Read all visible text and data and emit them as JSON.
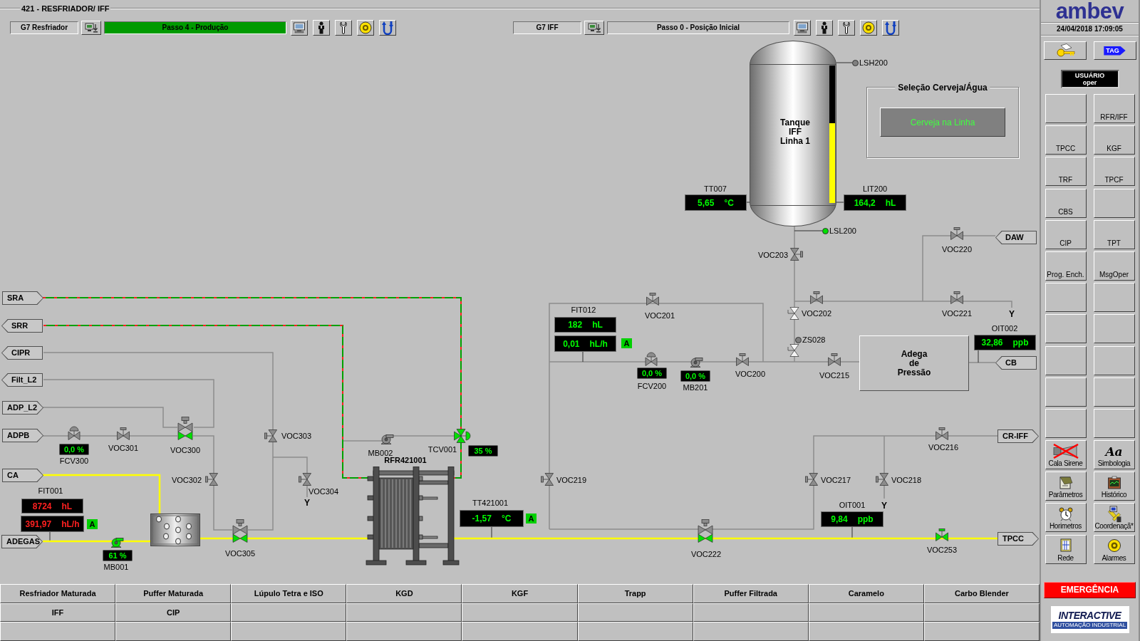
{
  "header": {
    "title": "421 - RESFRIADOR/ IFF"
  },
  "units": [
    {
      "name": "G7 Resfriador",
      "step": "Passo 4 - Produção",
      "running": true
    },
    {
      "name": "G7 IFF",
      "step": "Passo 0 - Posição Inicial",
      "running": false
    }
  ],
  "tank": {
    "lines": [
      "Tanque",
      "IFF",
      "Linha 1"
    ],
    "level": 0.58
  },
  "selection": {
    "title": "Seleção Cerveja/Água",
    "button": "Cerveja na Linha"
  },
  "switches": [
    {
      "tag": "LSH200",
      "active": false
    },
    {
      "tag": "LSL200",
      "active": true
    },
    {
      "tag": "ZS028",
      "active": false
    }
  ],
  "instruments": [
    {
      "tag": "TT007",
      "alarm": false,
      "readings": [
        {
          "value": "5,65",
          "unit": "°C"
        }
      ]
    },
    {
      "tag": "LIT200",
      "alarm": false,
      "readings": [
        {
          "value": "164,2",
          "unit": "hL"
        }
      ]
    },
    {
      "tag": "FIT012",
      "alarm": false,
      "readings": [
        {
          "value": "182",
          "unit": "hL"
        },
        {
          "value": "0,01",
          "unit": "hL/h"
        }
      ],
      "mode": "A"
    },
    {
      "tag": "OIT002",
      "alarm": false,
      "readings": [
        {
          "value": "32,86",
          "unit": "ppb"
        }
      ]
    },
    {
      "tag": "FIT001",
      "alarm": true,
      "readings": [
        {
          "value": "8724",
          "unit": "hL"
        },
        {
          "value": "391,97",
          "unit": "hL/h"
        }
      ],
      "mode": "A"
    },
    {
      "tag": "TT421001",
      "alarm": false,
      "readings": [
        {
          "value": "-1,57",
          "unit": "°C"
        }
      ],
      "mode": "A"
    },
    {
      "tag": "OIT001",
      "alarm": false,
      "readings": [
        {
          "value": "9,84",
          "unit": "ppb"
        }
      ]
    }
  ],
  "connectors": [
    {
      "label": "SRA",
      "kind": "right"
    },
    {
      "label": "SRR",
      "kind": "left"
    },
    {
      "label": "CIPR",
      "kind": "left"
    },
    {
      "label": "Filt_L2",
      "kind": "left"
    },
    {
      "label": "ADP_L2",
      "kind": "right"
    },
    {
      "label": "ADPB",
      "kind": "right"
    },
    {
      "label": "CA",
      "kind": "right"
    },
    {
      "label": "ADEGAS",
      "kind": "right"
    },
    {
      "label": "DAW",
      "kind": "left"
    },
    {
      "label": "CB",
      "kind": "left"
    },
    {
      "label": "CR-IFF",
      "kind": "right"
    },
    {
      "label": "TPCC",
      "kind": "right"
    }
  ],
  "vessel": {
    "lines": [
      "Adega",
      "de",
      "Pressão"
    ]
  },
  "valves": [
    {
      "tag": "VOC203",
      "kind": "onoff",
      "open": false
    },
    {
      "tag": "VOC220",
      "kind": "onoff",
      "open": false
    },
    {
      "tag": "VOC201",
      "kind": "onoff",
      "open": false
    },
    {
      "tag": "VOC202",
      "kind": "onoff",
      "open": false
    },
    {
      "tag": "VOC221",
      "kind": "onoff",
      "open": false
    },
    {
      "tag": "FCV200",
      "kind": "control",
      "open": false,
      "reading": "0,0 %"
    },
    {
      "tag": "VOC200",
      "kind": "onoff",
      "open": false
    },
    {
      "tag": "VOC215",
      "kind": "onoff",
      "open": false
    },
    {
      "tag": "FCV300",
      "kind": "control",
      "open": false,
      "reading": "0,0 %"
    },
    {
      "tag": "VOC301",
      "kind": "onoff",
      "open": false
    },
    {
      "tag": "VOC300",
      "kind": "double",
      "open": true
    },
    {
      "tag": "VOC303",
      "kind": "onoff",
      "open": false
    },
    {
      "tag": "TCV001",
      "kind": "threeway",
      "open": true,
      "reading": "35 %"
    },
    {
      "tag": "VOC216",
      "kind": "onoff",
      "open": false
    },
    {
      "tag": "VOC302",
      "kind": "onoff",
      "open": false
    },
    {
      "tag": "VOC219",
      "kind": "onoff",
      "open": false
    },
    {
      "tag": "VOC217",
      "kind": "onoff",
      "open": false
    },
    {
      "tag": "VOC218",
      "kind": "onoff",
      "open": false
    },
    {
      "tag": "VOC304",
      "kind": "onoff",
      "open": false
    },
    {
      "tag": "VOC305",
      "kind": "double",
      "open": true
    },
    {
      "tag": "VOC222",
      "kind": "double",
      "open": true
    },
    {
      "tag": "VOC253",
      "kind": "onoff",
      "open": true
    }
  ],
  "pumps": [
    {
      "tag": "MB002",
      "running": false
    },
    {
      "tag": "MB201",
      "running": false,
      "reading": "0,0 %"
    },
    {
      "tag": "MB001",
      "running": true,
      "reading": "61 %"
    }
  ],
  "heat_exchanger": {
    "tag": "RFR421001"
  },
  "drains": [
    "Y",
    "Y",
    "Y"
  ],
  "bottom_menu": [
    "Resfriador Maturada",
    "Puffer Maturada",
    "Lúpulo Tetra e ISO",
    "KGD",
    "KGF",
    "Trapp",
    "Puffer Filtrada",
    "Caramelo",
    "Carbo Blender",
    "IFF",
    "CIP"
  ],
  "sidebar": {
    "logo": "ambev",
    "datetime": "24/04/2018 17:09:05",
    "tag_button": "TAG",
    "user": {
      "title": "USUÁRIO",
      "name": "oper"
    },
    "nav_buttons": [
      {
        "kind": "blank"
      },
      {
        "kind": "text",
        "label": "RFR/IFF"
      },
      {
        "kind": "text",
        "label": "TPCC"
      },
      {
        "kind": "text",
        "label": "KGF"
      },
      {
        "kind": "text",
        "label": "TRF"
      },
      {
        "kind": "text",
        "label": "TPCF"
      },
      {
        "kind": "text",
        "label": "CBS"
      },
      {
        "kind": "blank"
      },
      {
        "kind": "text",
        "label": "CIP"
      },
      {
        "kind": "text",
        "label": "TPT"
      },
      {
        "kind": "text",
        "label": "Prog. Ench."
      },
      {
        "kind": "text",
        "label": "MsgOper"
      },
      {
        "kind": "blank"
      },
      {
        "kind": "blank"
      },
      {
        "kind": "blank"
      },
      {
        "kind": "blank"
      },
      {
        "kind": "blank"
      },
      {
        "kind": "blank"
      },
      {
        "kind": "blank"
      },
      {
        "kind": "blank"
      },
      {
        "kind": "blank"
      },
      {
        "kind": "blank"
      }
    ],
    "tool_glyph": "Aa",
    "tools": [
      {
        "label": "Cala Sirene"
      },
      {
        "label": "Simbologia"
      },
      {
        "label": "Parâmetros"
      },
      {
        "label": "Histórico"
      },
      {
        "label": "Horimetros"
      },
      {
        "label": "Coordenaçã*"
      },
      {
        "label": "Rede"
      },
      {
        "label": "Alarmes"
      }
    ],
    "emergency": "EMERGÊNCIA",
    "vendor": {
      "name": "INTERACTIVE",
      "tagline": "AUTOMAÇÃO INDUSTRIAL"
    }
  }
}
